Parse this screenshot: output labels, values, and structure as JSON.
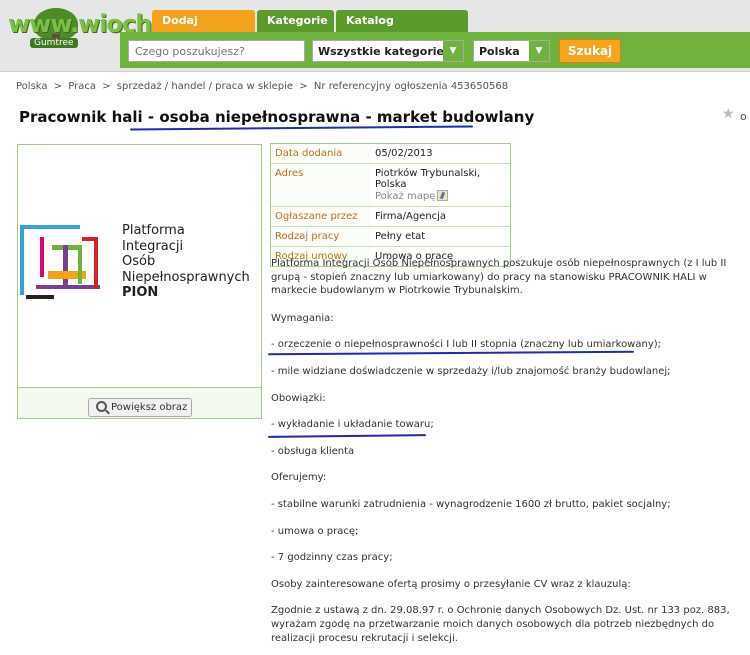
{
  "header": {
    "watermark": "www.wiocha.pl",
    "brand": "Gumtree",
    "tabs": [
      "Dodaj ogłoszenie",
      "Kategorie",
      "Katalog sprzedawców"
    ],
    "search_placeholder": "Czego poszukujesz?",
    "category_value": "Wszystkie kategorie",
    "location_value": "Polska",
    "search_button": "Szukaj"
  },
  "breadcrumb": {
    "items": [
      "Polska",
      "Praca",
      "sprzedaż / handel / praca w sklepie",
      "Nr referencyjny ogłoszenia 453650568"
    ],
    "separator": ">"
  },
  "ad": {
    "title": "Pracownik hali - osoba niepełnosprawna - market budowlany",
    "star_label": "o",
    "logo_lines": [
      "Platforma",
      "Integracji",
      "Osób",
      "Niepełnosprawnych",
      "PION"
    ],
    "logo_colors": [
      "#3aa0d8",
      "#e4007c",
      "#f2a21b",
      "#6ab63a",
      "#7b3f8f",
      "#d62027",
      "#222222"
    ],
    "enlarge_button": "Powiększ obraz",
    "details": [
      {
        "label": "Data dodania",
        "value": "05/02/2013"
      },
      {
        "label": "Adres",
        "value": "Piotrków Trybunalski, Polska",
        "extra": "Pokaż mapę"
      },
      {
        "label": "Ogłaszane przez",
        "value": "Firma/Agencja"
      },
      {
        "label": "Rodzaj pracy",
        "value": "Pełny etat"
      },
      {
        "label": "Rodzaj umowy",
        "value": "Umowa o pracę"
      }
    ],
    "description": [
      "Platforma Integracji Osób Niepełnosprawnych poszukuje osób niepełnosprawnych (z I lub II grupą - stopień znaczny lub umiarkowany) do pracy na stanowisku PRACOWNIK HALI w markecie budowlanym w Piotrkowie Trybunalskim.",
      "Wymagania:",
      "- orzeczenie o niepełnosprawności I lub II stopnia (znaczny lub umiarkowany);",
      "- mile widziane doświadczenie w sprzedaży i/lub znajomość branży budowlanej;",
      "Obowiązki:",
      "- wykładanie i układanie towaru;",
      "- obsługa klienta",
      "Oferujemy:",
      "- stabilne warunki zatrudnienia - wynagrodzenie 1600 zł brutto, pakiet socjalny;",
      "- umowa o pracę;",
      "- 7 godzinny czas pracy;",
      "Osoby zainteresowane ofertą prosimy o przesyłanie CV wraz z klauzulą:",
      "Zgodnie z ustawą z dn. 29.08.97 r. o Ochronie danych Osobowych Dz. Ust. nr 133 poz. 883, wyrażam zgodę na przetwarzanie moich danych osobowych dla potrzeb niezbędnych do realizacji procesu rekrutacji i selekcji."
    ],
    "highlight_color": "#1a2fa8"
  }
}
